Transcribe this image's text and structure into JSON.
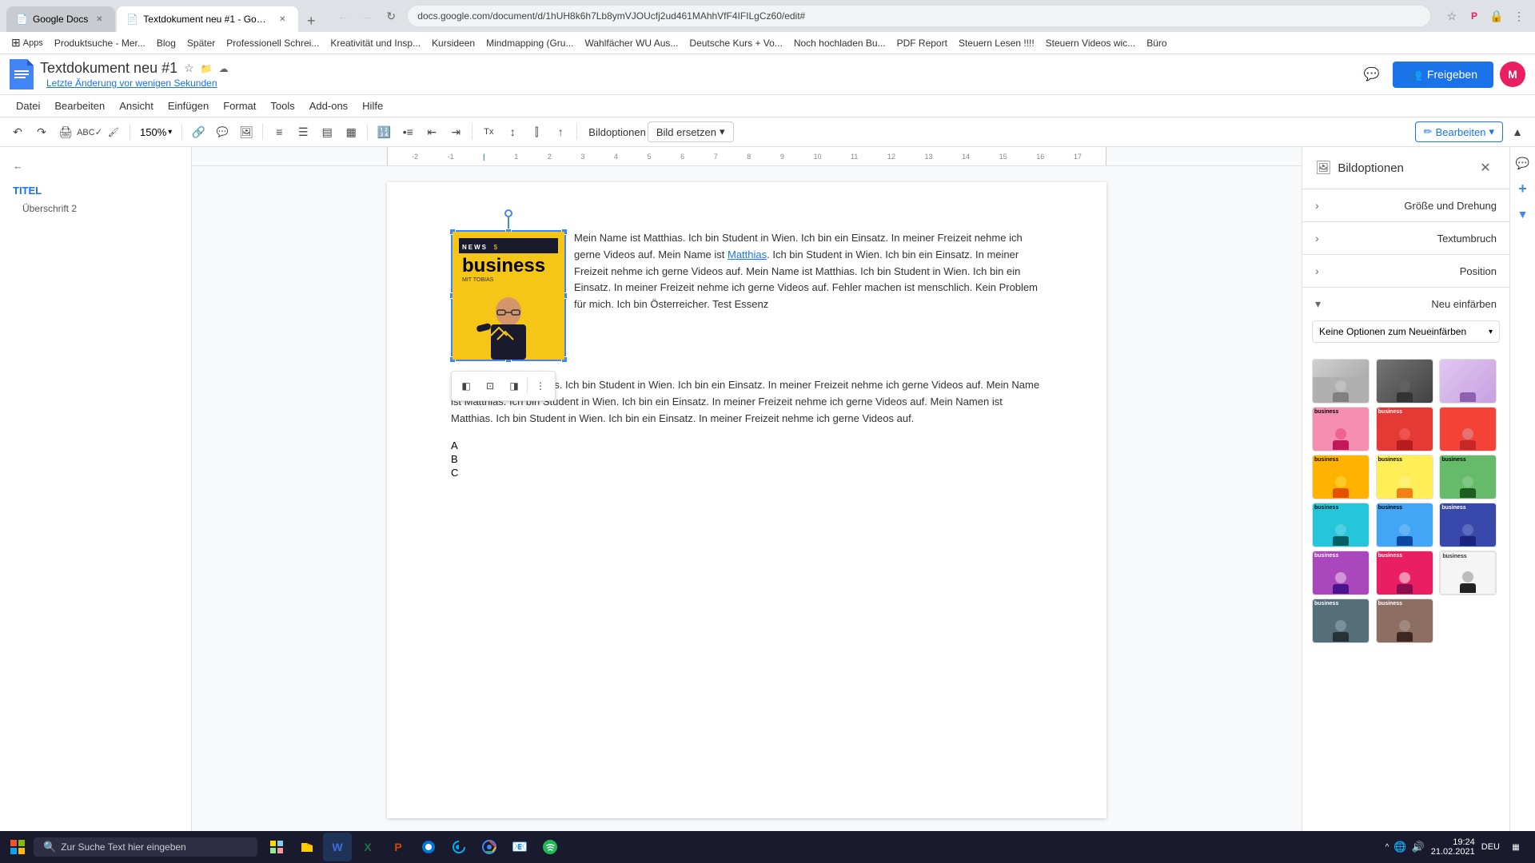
{
  "browser": {
    "tabs": [
      {
        "id": "tab1",
        "label": "Google Docs",
        "favicon": "📄",
        "active": false
      },
      {
        "id": "tab2",
        "label": "Textdokument neu #1 - Google ...",
        "favicon": "📄",
        "active": true
      }
    ],
    "url": "docs.google.com/document/d/1hUH8k6h7Lb8ymVJOUcfj2ud461MAhhVfF4IFILgCz60/edit#",
    "bookmarks": [
      {
        "label": "Apps",
        "icon": "⋮"
      },
      {
        "label": "Produktsuche - Mer...",
        "icon": ""
      },
      {
        "label": "Blog",
        "icon": ""
      },
      {
        "label": "Später",
        "icon": ""
      },
      {
        "label": "Professionell Schrei...",
        "icon": ""
      },
      {
        "label": "Kreativität und Insp...",
        "icon": ""
      },
      {
        "label": "Kursideen",
        "icon": ""
      },
      {
        "label": "Mindmapping (Gru...",
        "icon": ""
      },
      {
        "label": "Wahlfächer WU Aus...",
        "icon": ""
      },
      {
        "label": "Deutsche Kurs + Vo...",
        "icon": ""
      },
      {
        "label": "Noch hochladen Bu...",
        "icon": ""
      },
      {
        "label": "PDF Report",
        "icon": ""
      },
      {
        "label": "Steuern Lesen !!!!",
        "icon": ""
      },
      {
        "label": "Steuern Videos wic...",
        "icon": ""
      },
      {
        "label": "Büro",
        "icon": ""
      }
    ]
  },
  "gdocs": {
    "logo_color": "#4285F4",
    "doc_title": "Textdokument neu #1",
    "last_modified": "Letzte Änderung vor wenigen Sekunden",
    "share_button": "Freigeben",
    "menu": {
      "items": [
        "Datei",
        "Bearbeiten",
        "Ansicht",
        "Einfügen",
        "Format",
        "Tools",
        "Add-ons",
        "Hilfe"
      ]
    },
    "toolbar": {
      "zoom": "150%",
      "image_options_label": "Bildoptionen",
      "image_replace_label": "Bild ersetzen",
      "edit_btn": "Bearbeiten"
    }
  },
  "outline": {
    "back_label": "",
    "title": "TITEL",
    "heading2": "Überschrift 2"
  },
  "document": {
    "paragraph1": "Mein Name ist Matthias. Ich bin Student in Wien. Ich bin ein Einsatz. In meiner Freizeit nehme ich gerne Videos auf. Mein Name ist ",
    "link_text": "Matthias",
    "paragraph1_cont": ". Ich bin Student in Wien. Ich bin ein Einsatz. In meiner Freizeit nehme ich gerne Videos auf. Mein Name ist Matthias. Ich bin Student in Wien. Ich bin ein Einsatz. In meiner Freizeit nehme ich gerne Videos auf. Fehler machen ist menschlich. Kein Problem für mich. Ich bin Österreicher. Test Essenz",
    "paragraph2": "Mein Name ist Matthias. Ich bin Student in Wien. Ich bin ein Einsatz. In meiner Freizeit nehme ich gerne Videos auf. Mein Name ist Matthias. Ich bin Student in Wien. Ich bin ein Einsatz. In meiner Freizeit nehme ich gerne Videos auf. Mein Namen ist Matthias. Ich bin Student in Wien. Ich bin ein Einsatz. In meiner Freizeit nehme ich gerne Videos auf.",
    "list": [
      "A",
      "B",
      "C"
    ]
  },
  "image_thumbnail": {
    "news_label": "NEWS",
    "business_label": "business",
    "mit_label": "MIT TOBIAS"
  },
  "panel": {
    "title": "Bildoptionen",
    "close_icon": "✕",
    "sections": [
      {
        "label": "Größe und Drehung",
        "expanded": false
      },
      {
        "label": "Textumbruch",
        "expanded": false
      },
      {
        "label": "Position",
        "expanded": false
      }
    ],
    "recolor_section": {
      "label": "Neu einfärben",
      "expanded": true,
      "dropdown_label": "Keine Optionen zum Neueinfärben"
    },
    "swatches": [
      {
        "id": "sw1",
        "class": "swatch-gray-light",
        "label": "Grau hell"
      },
      {
        "id": "sw2",
        "class": "swatch-gray-dark",
        "label": "Grau dunkel"
      },
      {
        "id": "sw3",
        "class": "swatch-pink-light",
        "label": "Rosa"
      },
      {
        "id": "sw4",
        "class": "swatch-pink-light",
        "label": "Rosa hell"
      },
      {
        "id": "sw5",
        "class": "swatch-red",
        "label": "Rot"
      },
      {
        "id": "sw6",
        "class": "swatch-red",
        "label": "Dunkelrot"
      },
      {
        "id": "sw7",
        "class": "swatch-orange",
        "label": "Orange"
      },
      {
        "id": "sw8",
        "class": "swatch-yellow",
        "label": "Gelb"
      },
      {
        "id": "sw9",
        "class": "swatch-green-light",
        "label": "Grün"
      },
      {
        "id": "sw10",
        "class": "swatch-teal",
        "label": "Türkis"
      },
      {
        "id": "sw11",
        "class": "swatch-blue-light",
        "label": "Hellblau"
      },
      {
        "id": "sw12",
        "class": "swatch-blue-dark",
        "label": "Dunkelblau"
      },
      {
        "id": "sw13",
        "class": "swatch-purple",
        "label": "Lila"
      },
      {
        "id": "sw14",
        "class": "swatch-pink-bright",
        "label": "Pink"
      },
      {
        "id": "sw15",
        "class": "swatch-dark-gray",
        "label": "Dunkelgrau"
      },
      {
        "id": "sw16",
        "class": "swatch-dark-brown",
        "label": "Braun"
      },
      {
        "id": "sw17",
        "class": "swatch-white",
        "label": "Weiß"
      },
      {
        "id": "sw18",
        "class": "swatch-dark-gray",
        "label": "Schwarz"
      }
    ]
  },
  "taskbar": {
    "search_placeholder": "Zur Suche Text hier eingeben",
    "time": "19:24",
    "date": "21.02.2021",
    "lang": "DEU"
  }
}
